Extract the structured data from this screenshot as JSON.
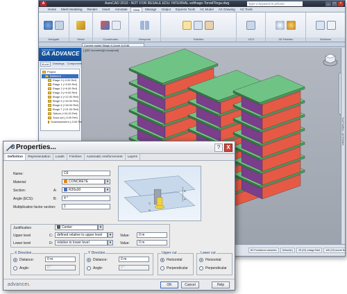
{
  "acad": {
    "title": "AutoCAD 2010 - NOT FOR RESALE   EDU: INTERNAL   softhage-ToroidTinga.dwg",
    "logo": "A",
    "search_placeholder": "Type a keyword or phrase",
    "ribbon_tabs": [
      "Home",
      "Mesh Modeling",
      "Render",
      "Insert",
      "Annotate",
      "View",
      "Manage",
      "Output",
      "Express Tools",
      "AC Model",
      "AC Drawing",
      "AC Tools"
    ],
    "active_tab": "View",
    "panels": [
      "Navigate",
      "Views",
      "Coordinates",
      "Viewports",
      "Palettes",
      "UCS",
      "3D Palettes",
      "Windows"
    ],
    "palette_tools": [
      "Tool Palettes",
      "Properties",
      "Sheet Set Manager",
      "Visual Styles",
      "Materials",
      "Lights"
    ],
    "window_tools": [
      "Switch Windows",
      "Status Bar"
    ],
    "doc_tab": "Current model     Stage 4 (Level 4) Edit",
    "viewport_label": "[-][SE Isometric][Conceptual]"
  },
  "graphisoft": {
    "brand_small": "GRAPHISOFT",
    "brand": "GA ADVANCE",
    "tabs": [
      "Model",
      "Drawings",
      "Components"
    ],
    "active_tab": "Model",
    "tree": [
      {
        "label": "Project",
        "level": 0
      },
      {
        "label": "Batiment",
        "level": 1
      },
      {
        "label": "Etage 0 (-0.00 Ref)",
        "level": 2
      },
      {
        "label": "Etage 1 (+3.00 Ref)",
        "level": 2
      },
      {
        "label": "Etage 2 (+6.00 Ref)",
        "level": 2
      },
      {
        "label": "Etage 3 (+9.00 Ref)",
        "level": 2
      },
      {
        "label": "Etage 4 (+12.00 Ref)",
        "level": 2
      },
      {
        "label": "Etage 5 (+15.00 Ref)",
        "level": 2
      },
      {
        "label": "Etage 6 (+18.00 Ref)",
        "level": 2
      },
      {
        "label": "Etage 7 (+21.00 Ref)",
        "level": 2
      },
      {
        "label": "Toiture (+24.00 Ref)",
        "level": 2
      },
      {
        "label": "Sous-sol (-3.00 Ref)",
        "level": 2
      },
      {
        "label": "Soubassement (-3.00 Ref)",
        "level": 2
      }
    ],
    "selected_index": 1
  },
  "status_bar": [
    "B2 Fondations variantes",
    "Default(1)",
    "28 (23) collage Bat1",
    "WD (23) tunnel Bat1"
  ],
  "side_palette": "Tool Palettes - All Palettes",
  "dialog": {
    "title": "Properties...",
    "help": "?",
    "close": "X",
    "tabs": [
      "Definition",
      "Representation",
      "Loads",
      "Finishes",
      "Automatic reinforcement",
      "Layers"
    ],
    "active_tab": "Definition",
    "name_label": "Name:",
    "name_value": "C6",
    "material_label": "Material:",
    "material_value": "CONCRETE",
    "section_label": "Section:",
    "section_key": "A:",
    "section_value": "R20x30",
    "angle_label": "Angle (ECS):",
    "angle_key": "B:",
    "angle_value": "4 °",
    "mult_label": "Multiplication factor section:",
    "mult_value": "1",
    "justification_label": "Justification",
    "justification_value": "Center",
    "upper_label": "Upper level",
    "upper_key": "C:",
    "upper_value": "defined relative to upper level",
    "upper_value_label": "Value:",
    "upper_value_num": "0 m",
    "lower_label": "Lower level",
    "lower_key": "D:",
    "lower_value": "relative to lower level",
    "lower_value_label": "Value:",
    "lower_value_num": "0 m",
    "x_dir": {
      "title": "X Direction",
      "opt1": "Distance:",
      "opt2": "Angle:",
      "val1": "0 m",
      "val2": "0 °"
    },
    "y_dir": {
      "title": "Y Direction",
      "opt1": "Distance:",
      "opt2": "Angle:",
      "val1": "0 m",
      "val2": "0 °"
    },
    "upper_cut": {
      "title": "Upper cut",
      "opt1": "Horizontal",
      "opt2": "Perpendicular"
    },
    "lower_cut": {
      "title": "Lower cut",
      "opt1": "Horizontal",
      "opt2": "Perpendicular"
    },
    "brand": "advance",
    "ok": "OK",
    "cancel": "Cancel",
    "help_btn": "Help"
  },
  "colors": {
    "brick": "#e65a45",
    "purple": "#7a3e8c",
    "slab": "#3fa35a",
    "ga_blue": "#1d5fae",
    "window_blue": "#6a90c8"
  }
}
